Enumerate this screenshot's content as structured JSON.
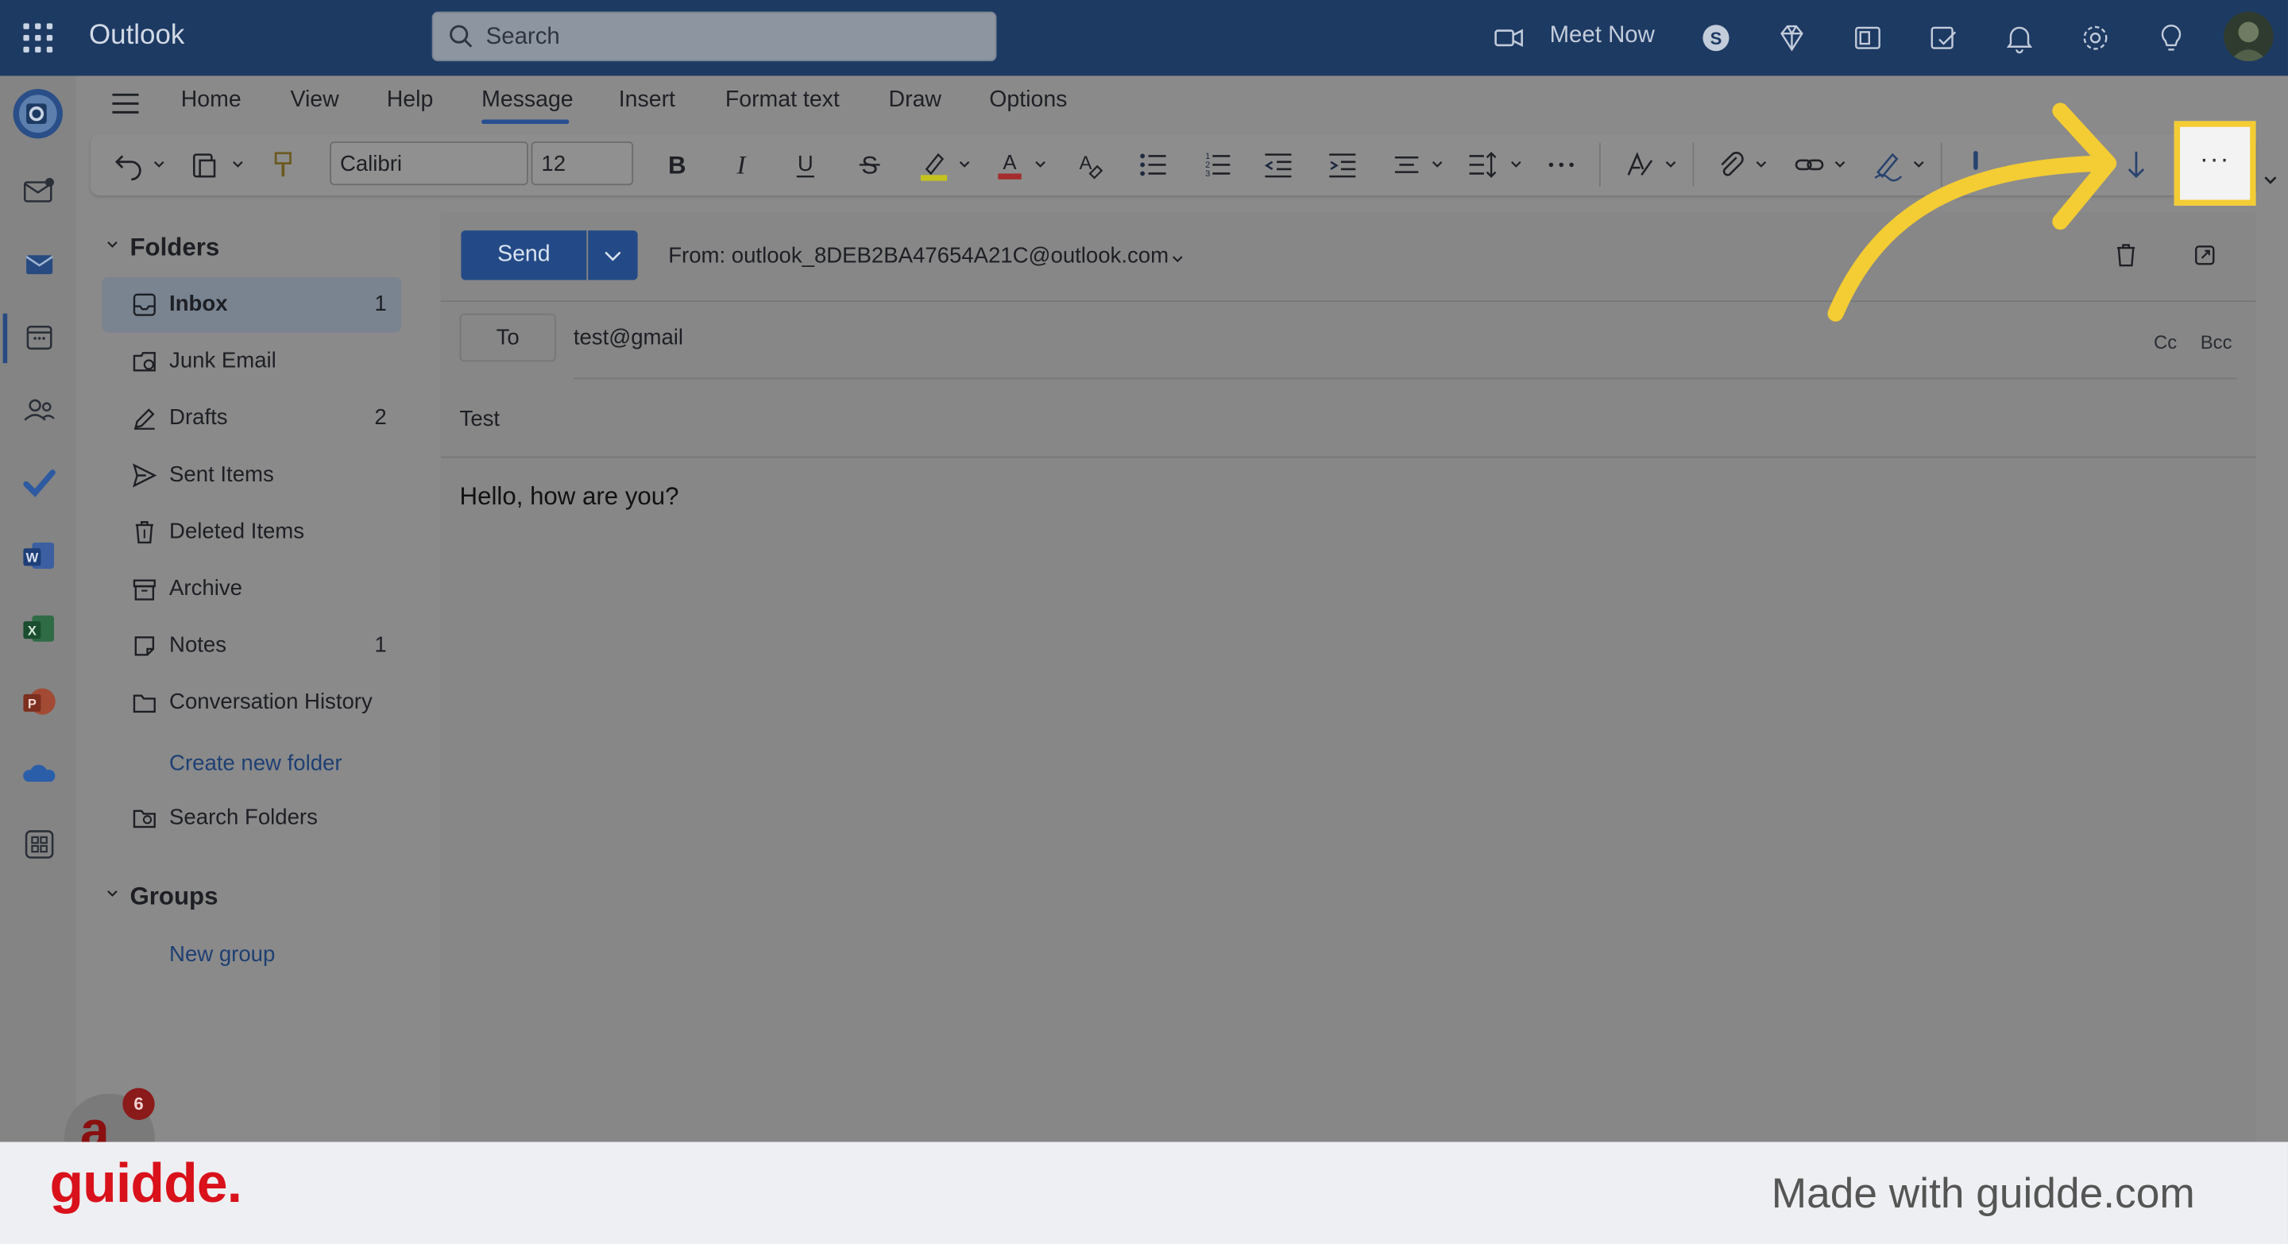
{
  "app": {
    "title": "Outlook"
  },
  "search": {
    "placeholder": "Search"
  },
  "topbar": {
    "meet_now": "Meet Now"
  },
  "ribbon": {
    "tabs": [
      "Home",
      "View",
      "Help",
      "Message",
      "Insert",
      "Format text",
      "Draw",
      "Options"
    ],
    "active_tab": "Message",
    "font_name": "Calibri",
    "font_size": "12",
    "more_options": "···"
  },
  "folders": {
    "header": "Folders",
    "items": [
      {
        "label": "Inbox",
        "count": "1"
      },
      {
        "label": "Junk Email",
        "count": ""
      },
      {
        "label": "Drafts",
        "count": "2"
      },
      {
        "label": "Sent Items",
        "count": ""
      },
      {
        "label": "Deleted Items",
        "count": ""
      },
      {
        "label": "Archive",
        "count": ""
      },
      {
        "label": "Notes",
        "count": "1"
      },
      {
        "label": "Conversation History",
        "count": ""
      }
    ],
    "create_new": "Create new folder",
    "search_folders": "Search Folders"
  },
  "groups": {
    "header": "Groups",
    "new_group": "New group"
  },
  "compose": {
    "send": "Send",
    "from": "From: outlook_8DEB2BA47654A21C@outlook.com",
    "to_label": "To",
    "to_value": "test@gmail",
    "cc": "Cc",
    "bcc": "Bcc",
    "subject": "Test",
    "body": "Hello, how are you?"
  },
  "badge": {
    "letter": "a",
    "count": "6"
  },
  "footer": {
    "logo": "guidde.",
    "made_with": "Made with guidde.com"
  },
  "colors": {
    "topbar": "#1d3a63",
    "send": "#234a86",
    "highlight": "#f4cc33",
    "guidde_red": "#d9111b"
  }
}
